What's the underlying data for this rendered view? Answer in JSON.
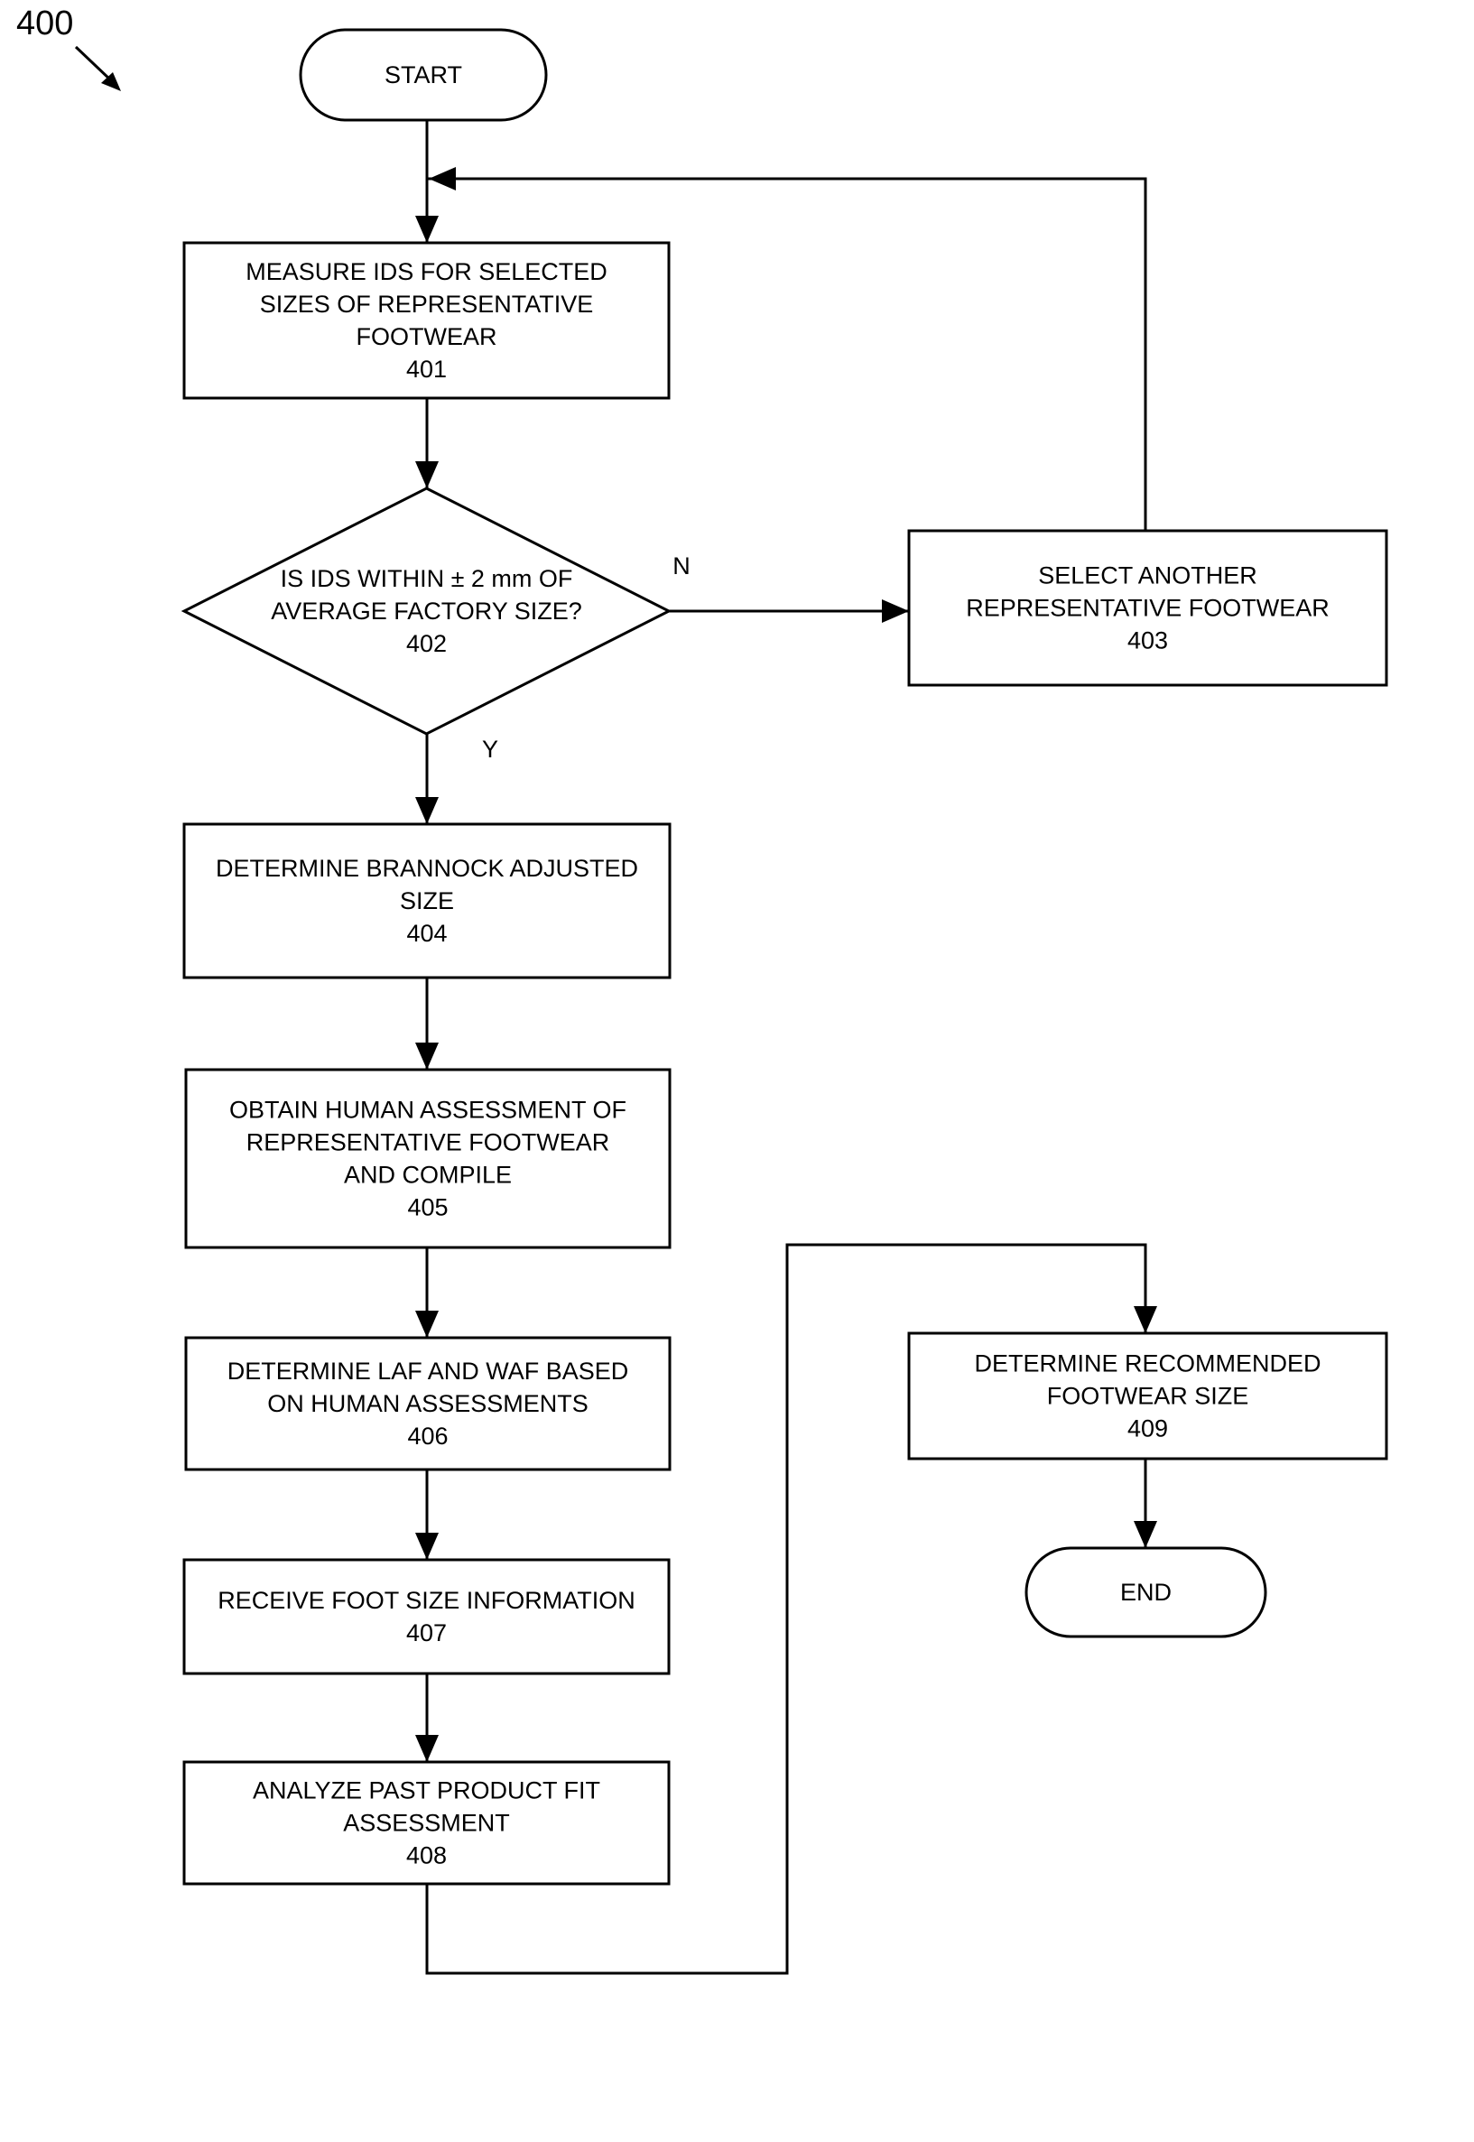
{
  "figure": {
    "label": "400",
    "arrow_icon": "diagonal-arrow-icon"
  },
  "nodes": {
    "start": {
      "type": "terminal",
      "lines": [
        "START"
      ]
    },
    "n401": {
      "type": "process",
      "lines": [
        "MEASURE IDS FOR SELECTED",
        "SIZES OF REPRESENTATIVE",
        "FOOTWEAR",
        "401"
      ]
    },
    "n402": {
      "type": "decision",
      "lines": [
        "IS IDS WITHIN ± 2 mm OF",
        "AVERAGE FACTORY SIZE?",
        "402"
      ]
    },
    "n403": {
      "type": "process",
      "lines": [
        "SELECT ANOTHER",
        "REPRESENTATIVE FOOTWEAR",
        "403"
      ]
    },
    "n404": {
      "type": "process",
      "lines": [
        "DETERMINE BRANNOCK ADJUSTED",
        "SIZE",
        "404"
      ]
    },
    "n405": {
      "type": "process",
      "lines": [
        "OBTAIN HUMAN ASSESSMENT OF",
        "REPRESENTATIVE FOOTWEAR",
        "AND COMPILE",
        "405"
      ]
    },
    "n406": {
      "type": "process",
      "lines": [
        "DETERMINE LAF AND WAF BASED",
        "ON HUMAN ASSESSMENTS",
        "406"
      ]
    },
    "n407": {
      "type": "process",
      "lines": [
        "RECEIVE FOOT SIZE INFORMATION",
        "407"
      ]
    },
    "n408": {
      "type": "process",
      "lines": [
        "ANALYZE PAST PRODUCT FIT",
        "ASSESSMENT",
        "408"
      ]
    },
    "n409": {
      "type": "process",
      "lines": [
        "DETERMINE RECOMMENDED",
        "FOOTWEAR SIZE",
        "409"
      ]
    },
    "end": {
      "type": "terminal",
      "lines": [
        "END"
      ]
    }
  },
  "branch_labels": {
    "no": "N",
    "yes": "Y"
  },
  "edges": [
    {
      "from": "start",
      "to": "n401"
    },
    {
      "from": "n401",
      "to": "n402"
    },
    {
      "from": "n402",
      "to": "n403",
      "label": "N"
    },
    {
      "from": "n403",
      "to": "n401"
    },
    {
      "from": "n402",
      "to": "n404",
      "label": "Y"
    },
    {
      "from": "n404",
      "to": "n405"
    },
    {
      "from": "n405",
      "to": "n406"
    },
    {
      "from": "n406",
      "to": "n407"
    },
    {
      "from": "n407",
      "to": "n408"
    },
    {
      "from": "n408",
      "to": "n409"
    },
    {
      "from": "n409",
      "to": "end"
    }
  ]
}
